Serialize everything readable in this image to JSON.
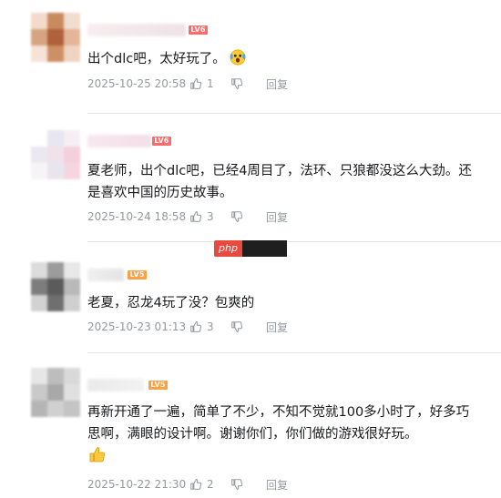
{
  "watermark": {
    "text": "php"
  },
  "comments": [
    {
      "level": "LV6",
      "level_color": "#fb6b6b",
      "text": "出个dlc吧，太好玩了。",
      "emoji": "shocked-face-emoji",
      "time": "2025-10-25 20:58",
      "likes": "1",
      "reply": "回复",
      "avatar_colors": [
        "#f3dacb",
        "#c98a5e",
        "#f1dccf",
        "#d6a57f",
        "#b0603a",
        "#e3b69a",
        "#f5e3d6",
        "#cf8f66",
        "#efd4c2"
      ]
    },
    {
      "level": "LV6",
      "level_color": "#fb6b6b",
      "text": "夏老师，出个dlc吧，已经4周目了，法环、只狼都没这么大劲。还是喜欢中国的历史故事。",
      "time": "2025-10-24 18:58",
      "likes": "3",
      "reply": "回复",
      "avatar_colors": [
        "#ffffff",
        "#e8e6ee",
        "#f6eef2",
        "#ebe8f0",
        "#f1e2ea",
        "#f3d0dc",
        "#f7f4f7",
        "#e9e5ee",
        "#f5d6e0"
      ]
    },
    {
      "level": "LV5",
      "level_color": "#ff9f43",
      "text": "老夏，忍龙4玩了没？包爽的",
      "time": "2025-10-23 01:13",
      "likes": "3",
      "reply": "回复",
      "avatar_colors": [
        "#dcdcdc",
        "#9c9c9c",
        "#e8e8e8",
        "#7d7d7d",
        "#5b5b5b",
        "#b9b9b9",
        "#d2d2d2",
        "#6f6f6f",
        "#cfcfcf"
      ]
    },
    {
      "level": "LV5",
      "level_color": "#ff9f43",
      "text": "再新开通了一遍，简单了不少，不知不觉就100多小时了，好多巧思啊，满眼的设计啊。谢谢你们，你们做的游戏很好玩。",
      "emoji": "thumbs-up-emoji",
      "time": "2025-10-22 21:30",
      "likes": "2",
      "reply": "回复",
      "avatar_colors": [
        "#e6e6e6",
        "#bdbdbd",
        "#d9d9d9",
        "#c9c9c9",
        "#a8a8a8",
        "#e0e0e0",
        "#b5b5b5",
        "#d0d0d0",
        "#c4c4c4"
      ]
    }
  ]
}
